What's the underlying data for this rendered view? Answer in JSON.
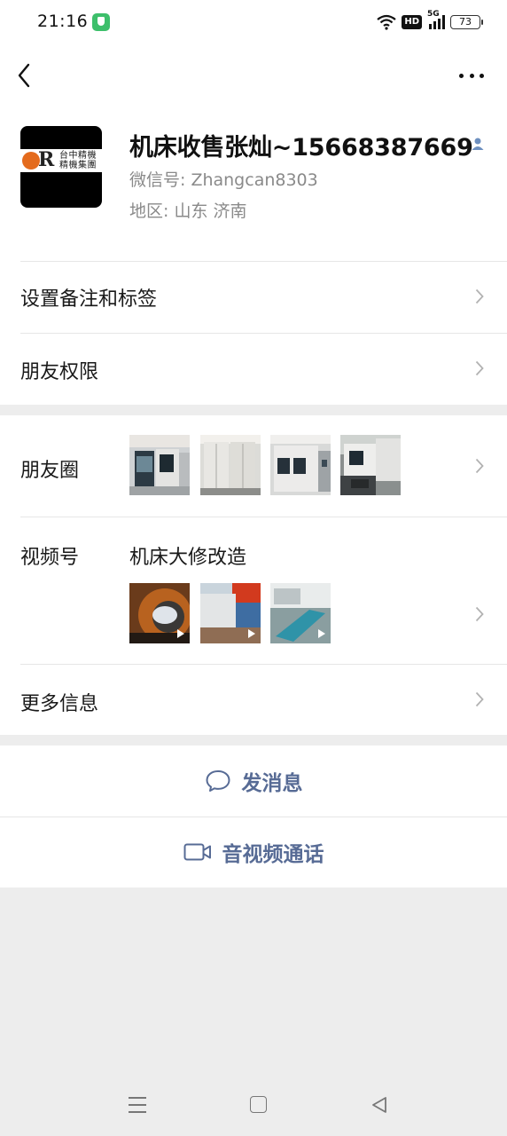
{
  "status_bar": {
    "time": "21:16",
    "network_badge": "HD",
    "network_type": "5G",
    "battery": "73"
  },
  "profile": {
    "name": "机床收售张灿~15668387669",
    "wechat_id": "微信号:  Zhangcan8303",
    "region": "地区:  山东  济南",
    "avatar_logo_letter": "R",
    "avatar_logo_text": "台中精機 精機集團"
  },
  "rows": {
    "remark_label": "设置备注和标签",
    "permissions_label": "朋友权限",
    "moments_label": "朋友圈",
    "channels_label": "视频号",
    "channels_name": "机床大修改造",
    "more_info_label": "更多信息"
  },
  "actions": {
    "message_label": "发消息",
    "call_label": "音视频通话"
  },
  "colors": {
    "link": "#576b95",
    "background": "#ededed",
    "accent_green": "#3dbf6b"
  },
  "icons": [
    "back-icon",
    "more-icon",
    "contact-icon",
    "chevron-right-icon",
    "chat-bubble-icon",
    "video-camera-icon",
    "menu-icon",
    "home-icon",
    "nav-back-icon"
  ]
}
